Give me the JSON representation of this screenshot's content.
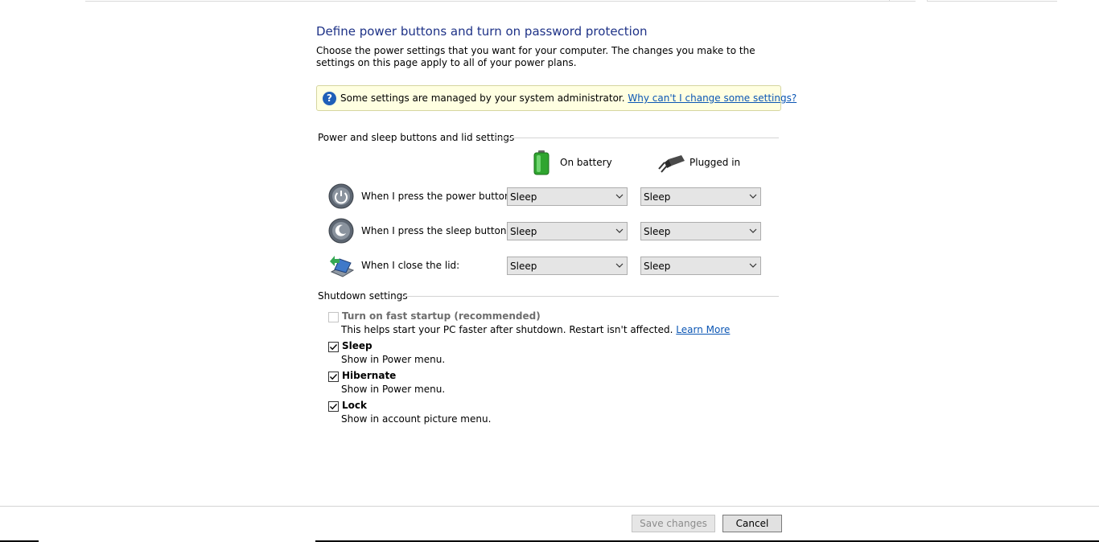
{
  "page": {
    "title": "Define power buttons and turn on password protection",
    "description": "Choose the power settings that you want for your computer. The changes you make to the settings on this page apply to all of your power plans."
  },
  "notice": {
    "text": "Some settings are managed by your system administrator.",
    "link": "Why can't I change some settings?",
    "background": "#ffffe1"
  },
  "buttons_section": {
    "heading": "Power and sleep buttons and lid settings",
    "columns": {
      "battery": "On battery",
      "plugged": "Plugged in"
    },
    "rows": [
      {
        "label": "When I press the power button:",
        "icon": "power-button-icon",
        "battery": "Sleep",
        "plugged": "Sleep"
      },
      {
        "label": "When I press the sleep button:",
        "icon": "sleep-button-icon",
        "battery": "Sleep",
        "plugged": "Sleep"
      },
      {
        "label": "When I close the lid:",
        "icon": "laptop-lid-icon",
        "battery": "Sleep",
        "plugged": "Sleep"
      }
    ]
  },
  "shutdown_section": {
    "heading": "Shutdown settings",
    "items": [
      {
        "label": "Turn on fast startup (recommended)",
        "description": "This helps start your PC faster after shutdown. Restart isn't affected.",
        "link": "Learn More",
        "checked": false,
        "enabled": false
      },
      {
        "label": "Sleep",
        "description": "Show in Power menu.",
        "checked": true,
        "enabled": true
      },
      {
        "label": "Hibernate",
        "description": "Show in Power menu.",
        "checked": true,
        "enabled": true
      },
      {
        "label": "Lock",
        "description": "Show in account picture menu.",
        "checked": true,
        "enabled": true
      }
    ]
  },
  "footer": {
    "save": "Save changes",
    "cancel": "Cancel"
  },
  "colors": {
    "title": "#1e3287",
    "link": "#0b56b4",
    "battery_green": "#3cb43c"
  }
}
